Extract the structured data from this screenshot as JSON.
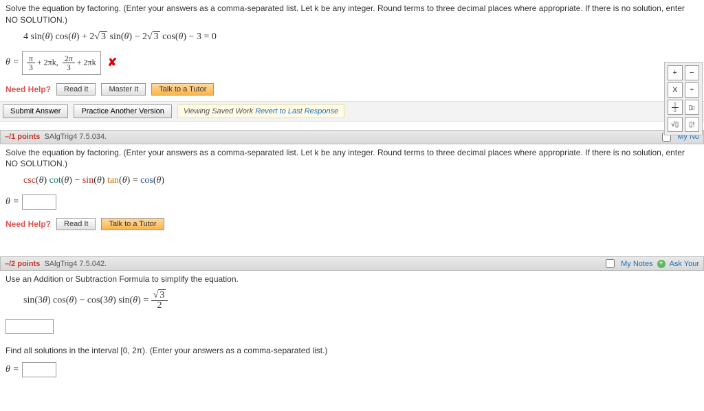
{
  "q1": {
    "instruction": "Solve the equation by factoring. (Enter your answers as a comma-separated list. Let k be any integer. Round terms to three decimal places where appropriate. If there is no solution, enter NO SOLUTION.)",
    "equation_html": "4 sin(θ) cos(θ) + 2√3 sin(θ) − 2√3 cos(θ) − 3 = 0",
    "theta_eq": "θ =",
    "answer_html": "π/3 + 2πk, 2π/3 + 2πk",
    "need_help": "Need Help?",
    "read_it": "Read It",
    "master_it": "Master It",
    "talk_tutor": "Talk to a Tutor",
    "submit": "Submit Answer",
    "practice": "Practice Another Version",
    "viewing": "Viewing Saved Work",
    "revert": "Revert to Last Response"
  },
  "q2": {
    "header_points": "–/1 points",
    "header_ref": "SAlgTrig4 7.5.034.",
    "my_notes": "My No",
    "instruction": "Solve the equation by factoring. (Enter your answers as a comma-separated list. Let k be any integer. Round terms to three decimal places where appropriate. If there is no solution, enter NO SOLUTION.)",
    "equation_html": "csc(θ) cot(θ) − sin(θ) tan(θ) = cos(θ)",
    "theta_eq": "θ =",
    "need_help": "Need Help?",
    "read_it": "Read It",
    "talk_tutor": "Talk to a Tutor"
  },
  "q3": {
    "header_points": "–/2 points",
    "header_ref": "SAlgTrig4 7.5.042.",
    "my_notes": "My Notes",
    "ask": "Ask Your",
    "instruction": "Use an Addition or Subtraction Formula to simplify the equation.",
    "equation_html": "sin(3θ) cos(θ) − cos(3θ) sin(θ) = √3 / 2",
    "instruction2": "Find all solutions in the interval [0, 2π). (Enter your answers as a comma-separated list.)",
    "theta_eq": "θ ="
  },
  "calc": {
    "plus": "+",
    "minus": "−",
    "times": "X",
    "div": "÷",
    "frac": "▯/▯",
    "exp": "▯▯",
    "sqrt": "√▯",
    "fact": "▯!"
  }
}
